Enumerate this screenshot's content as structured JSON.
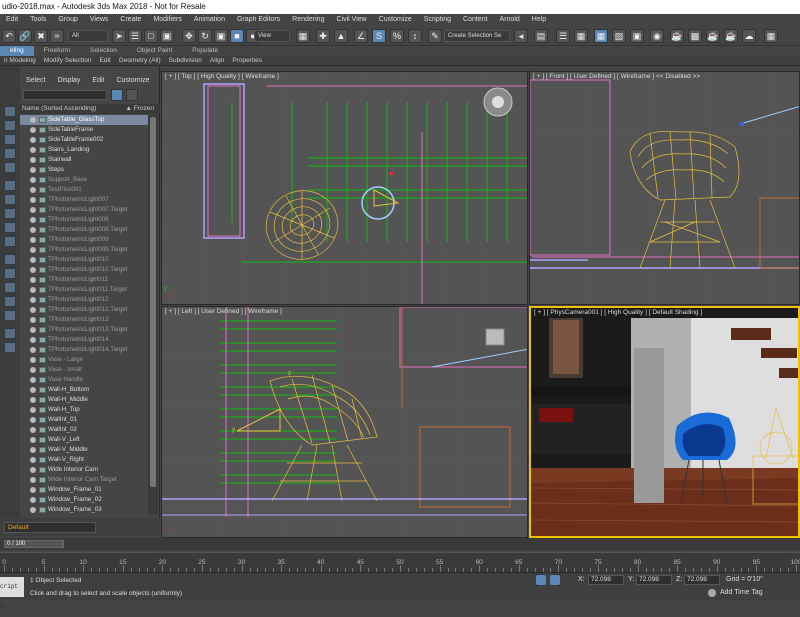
{
  "window": {
    "title": "udio-2018.max - Autodesk 3ds Max 2018 - Not for Resale"
  },
  "menu": [
    "Edit",
    "Tools",
    "Group",
    "Views",
    "Create",
    "Modifiers",
    "Animation",
    "Graph Editors",
    "Rendering",
    "Civil View",
    "Customize",
    "Scripting",
    "Content",
    "Arnold",
    "Help"
  ],
  "toolbar": {
    "selection_filter": "All",
    "reference_coord": "View",
    "named_selection": "Create Selection Se"
  },
  "ribbon": {
    "tabs": [
      "eling",
      "Freeform",
      "Selection",
      "Object Paint",
      "Populate"
    ],
    "active_tab": "eling",
    "subtabs": [
      "n Modeling",
      "Modify Selection",
      "Edit",
      "Geometry (All)",
      "Subdivision",
      "Align",
      "Properties"
    ]
  },
  "scene_explorer": {
    "menu": [
      "Select",
      "Display",
      "Edit",
      "Customize"
    ],
    "column_name": "Name (Sorted Ascending)",
    "column_frozen": "▲ Frozen",
    "rows": [
      {
        "name": "SideTable_GlassTop",
        "selected": true,
        "dim": false
      },
      {
        "name": "SideTableFrame",
        "selected": false,
        "dim": false
      },
      {
        "name": "SideTableFrame002",
        "selected": false,
        "dim": false
      },
      {
        "name": "Stairs_Landing",
        "selected": false,
        "dim": false
      },
      {
        "name": "Stairwall",
        "selected": false,
        "dim": false
      },
      {
        "name": "Steps",
        "selected": false,
        "dim": false
      },
      {
        "name": "Support_Base",
        "selected": false,
        "dim": true
      },
      {
        "name": "TestPlus001",
        "selected": false,
        "dim": true
      },
      {
        "name": "TPhotometricLight007",
        "selected": false,
        "dim": true
      },
      {
        "name": "TPhotometricLight007.Target",
        "selected": false,
        "dim": true
      },
      {
        "name": "TPhotometricLight008",
        "selected": false,
        "dim": true
      },
      {
        "name": "TPhotometricLight008.Target",
        "selected": false,
        "dim": true
      },
      {
        "name": "TPhotometricLight009",
        "selected": false,
        "dim": true
      },
      {
        "name": "TPhotometricLight009.Target",
        "selected": false,
        "dim": true
      },
      {
        "name": "TPhotometricLight010",
        "selected": false,
        "dim": true
      },
      {
        "name": "TPhotometricLight010.Target",
        "selected": false,
        "dim": true
      },
      {
        "name": "TPhotometricLight011",
        "selected": false,
        "dim": true
      },
      {
        "name": "TPhotometricLight011.Target",
        "selected": false,
        "dim": true
      },
      {
        "name": "TPhotometricLight012",
        "selected": false,
        "dim": true
      },
      {
        "name": "TPhotometricLight012.Target",
        "selected": false,
        "dim": true
      },
      {
        "name": "TPhotometricLight013",
        "selected": false,
        "dim": true
      },
      {
        "name": "TPhotometricLight013.Target",
        "selected": false,
        "dim": true
      },
      {
        "name": "TPhotometricLight014",
        "selected": false,
        "dim": true
      },
      {
        "name": "TPhotometricLight014.Target",
        "selected": false,
        "dim": true
      },
      {
        "name": "Vase - Large",
        "selected": false,
        "dim": true
      },
      {
        "name": "Vase - small",
        "selected": false,
        "dim": true
      },
      {
        "name": "Vase Handle",
        "selected": false,
        "dim": true
      },
      {
        "name": "Wall-H_Bottom",
        "selected": false,
        "dim": false
      },
      {
        "name": "Wall-H_Middle",
        "selected": false,
        "dim": false
      },
      {
        "name": "Wall-H_Top",
        "selected": false,
        "dim": false
      },
      {
        "name": "WallInt_01",
        "selected": false,
        "dim": false
      },
      {
        "name": "WallInt_02",
        "selected": false,
        "dim": false
      },
      {
        "name": "Wall-V_Left",
        "selected": false,
        "dim": false
      },
      {
        "name": "Wall-V_Middle",
        "selected": false,
        "dim": false
      },
      {
        "name": "Wall-V_Right",
        "selected": false,
        "dim": false
      },
      {
        "name": "Wide Interior Cam",
        "selected": false,
        "dim": false
      },
      {
        "name": "Wide Interior Cam.Target",
        "selected": false,
        "dim": true
      },
      {
        "name": "Window_Frame_01",
        "selected": false,
        "dim": false
      },
      {
        "name": "Window_Frame_02",
        "selected": false,
        "dim": false
      },
      {
        "name": "Window_Frame_03",
        "selected": false,
        "dim": false
      }
    ]
  },
  "workspace": {
    "label": "Default"
  },
  "viewports": {
    "top": "[ + ] [ Top ] [ High Quality ] [ Wireframe ]",
    "front": "[ + ] [ Front ] [ User Defined ] [ Wireframe ]  << Disabled >>",
    "left": "[ + ] [ Left ] [ User Defined ] [ Wireframe ]",
    "camera": "[ + ] [ PhysCamera001 ] [ High Quality ] [ Default Shading ]"
  },
  "timeline": {
    "slider": "0 / 100",
    "ticks": [
      "0",
      "5",
      "10",
      "15",
      "20",
      "25",
      "30",
      "35",
      "40",
      "45",
      "50",
      "55",
      "60",
      "65",
      "70",
      "75",
      "80",
      "85",
      "90",
      "95",
      "100"
    ]
  },
  "status": {
    "maxscript_label": "cript Mi",
    "selection": "1 Object Selected",
    "prompt": "Click and drag to select and scale objects (uniformly)",
    "x_label": "X:",
    "x_value": "72.098",
    "y_label": "Y:",
    "y_value": "72.098",
    "z_label": "Z:",
    "z_value": "72.098",
    "grid": "Grid = 0'10\"",
    "add_time_tag": "Add Time Tag"
  },
  "colors": {
    "viewport_bg": "#545454",
    "active_border": "#f0c000",
    "wire_yellow": "#e8c040",
    "wire_green": "#1fa81f",
    "wire_pink": "#e070c0",
    "wire_lavender": "#b0a0ff",
    "selected_row": "#7a8aa0"
  }
}
